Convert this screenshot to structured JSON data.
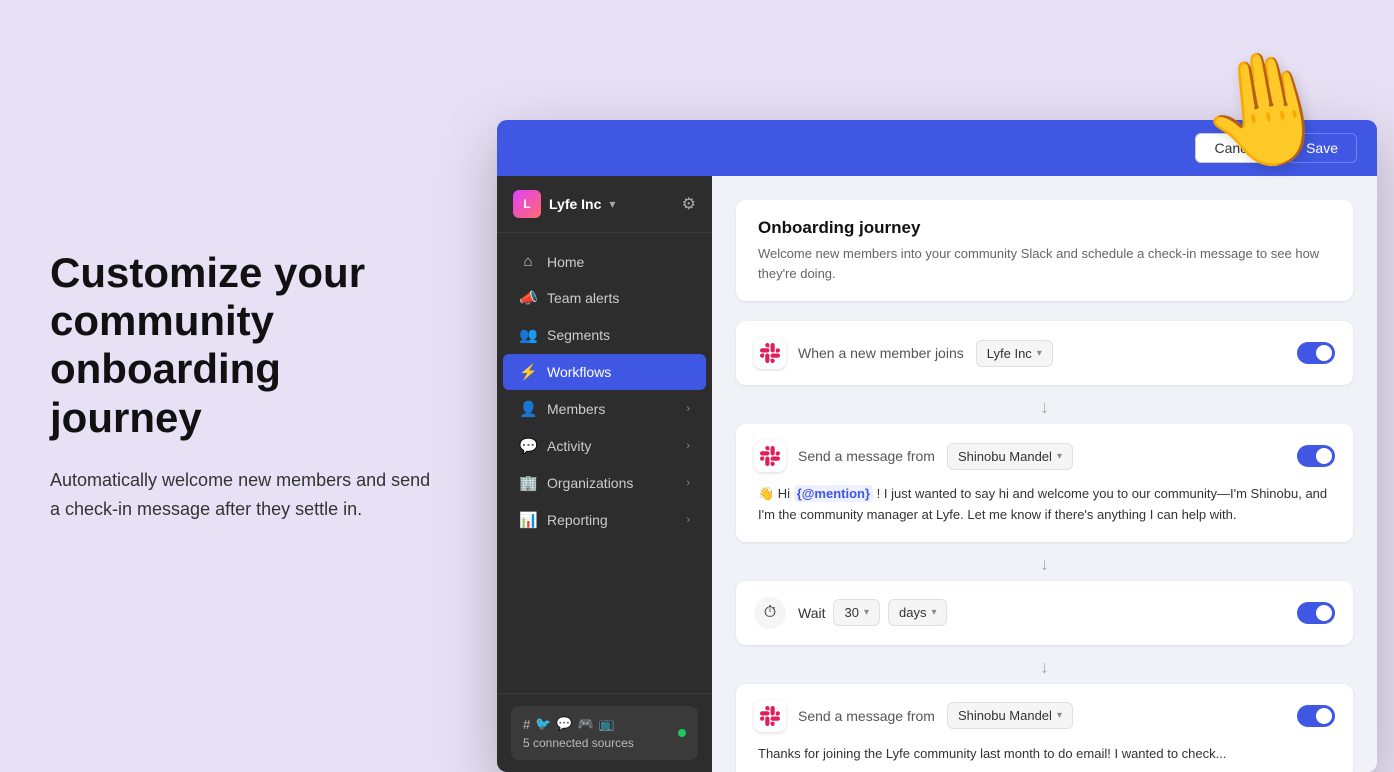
{
  "page": {
    "background_color": "#e8e0f5"
  },
  "left": {
    "heading": "Customize your community onboarding journey",
    "description": "Automatically welcome new members and send a check-in message after they settle in."
  },
  "hand_emoji": "🤚",
  "header": {
    "cancel_label": "Cancel",
    "save_label": "Save"
  },
  "sidebar": {
    "brand": {
      "name": "Lyfe Inc",
      "chevron": "▾"
    },
    "nav_items": [
      {
        "id": "home",
        "label": "Home",
        "icon": "⌂",
        "has_chevron": false,
        "active": false
      },
      {
        "id": "team-alerts",
        "label": "Team alerts",
        "icon": "📣",
        "has_chevron": false,
        "active": false
      },
      {
        "id": "segments",
        "label": "Segments",
        "icon": "👥",
        "has_chevron": false,
        "active": false
      },
      {
        "id": "workflows",
        "label": "Workflows",
        "icon": "⚡",
        "has_chevron": false,
        "active": true
      },
      {
        "id": "members",
        "label": "Members",
        "icon": "👤",
        "has_chevron": true,
        "active": false
      },
      {
        "id": "activity",
        "label": "Activity",
        "icon": "💬",
        "has_chevron": true,
        "active": false
      },
      {
        "id": "organizations",
        "label": "Organizations",
        "icon": "🏢",
        "has_chevron": true,
        "active": false
      },
      {
        "id": "reporting",
        "label": "Reporting",
        "icon": "📊",
        "has_chevron": true,
        "active": false
      }
    ],
    "footer": {
      "sources_count": "5 connected sources",
      "icons": [
        "#",
        "🐦",
        "💬",
        "🎮",
        "📺"
      ]
    }
  },
  "workflow": {
    "title": "Onboarding journey",
    "description": "Welcome new members into your community Slack and schedule a check-in message to see how they're doing.",
    "steps": [
      {
        "id": "trigger",
        "type": "trigger",
        "label": "When a new member joins",
        "select_value": "Lyfe Inc",
        "toggle_on": true
      },
      {
        "id": "message-1",
        "type": "message",
        "label": "Send a message from",
        "select_value": "Shinobu Mandel",
        "toggle_on": true,
        "message_text_prefix": "👋 Hi ",
        "mention": "{@mention}",
        "message_text_suffix": " ! I just wanted to say hi and welcome you to our community—I'm Shinobu, and I'm the community manager at Lyfe. Let me know if there's anything I can help with."
      },
      {
        "id": "wait",
        "type": "wait",
        "label": "Wait",
        "wait_value": "30",
        "wait_unit": "days",
        "toggle_on": true
      },
      {
        "id": "message-2",
        "type": "message",
        "label": "Send a message from",
        "select_value": "Shinobu Mandel",
        "toggle_on": true,
        "message_text_prefix": "Thanks for joining the Lyfe community last month to do email! I wanted to check..."
      }
    ]
  }
}
